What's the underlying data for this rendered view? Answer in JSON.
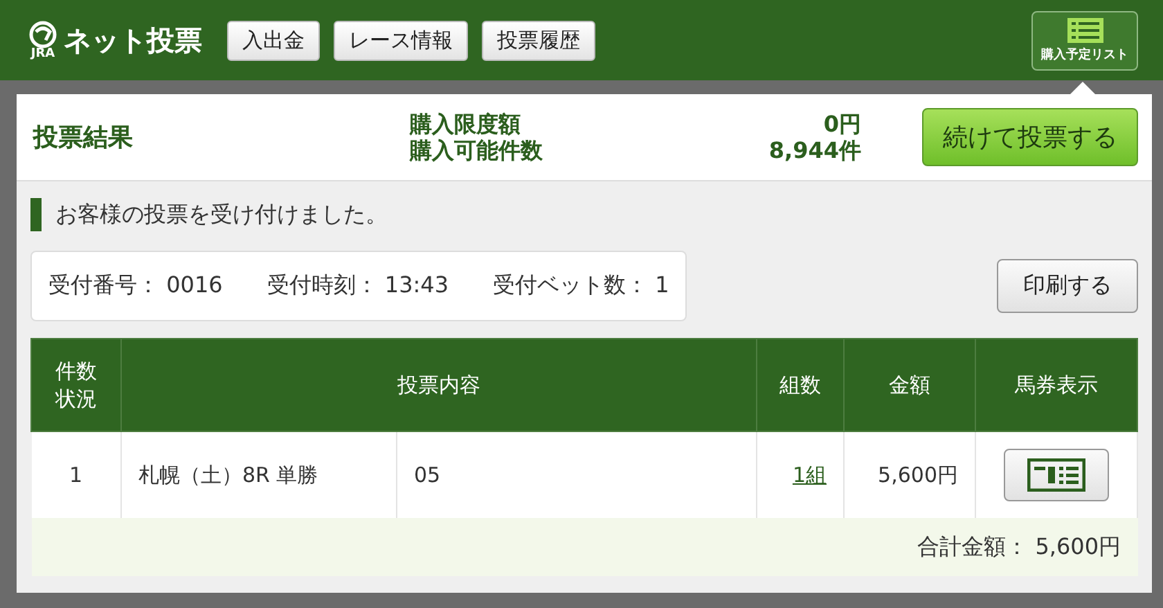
{
  "header": {
    "logo_mark": "JRA",
    "title": "ネット投票",
    "nav": [
      "入出金",
      "レース情報",
      "投票履歴"
    ],
    "list_button": "購入予定リスト"
  },
  "summary": {
    "title": "投票結果",
    "limits": [
      {
        "label": "購入限度額",
        "value": "0円"
      },
      {
        "label": "購入可能件数",
        "value": "8,944件"
      }
    ],
    "continue_button": "続けて投票する"
  },
  "message": "お客様の投票を受け付けました。",
  "receipt": [
    {
      "label": "受付番号：",
      "value": "0016"
    },
    {
      "label": "受付時刻：",
      "value": "13:43"
    },
    {
      "label": "受付ベット数：",
      "value": "1"
    }
  ],
  "print_button": "印刷する",
  "table": {
    "columns": [
      "件数状況",
      "投票内容",
      "組数",
      "金額",
      "馬券表示"
    ],
    "rows": [
      {
        "count": "1",
        "race": "札幌（土）8R 単勝",
        "selection": "05",
        "combos": "1組",
        "amount": "5,600円"
      }
    ],
    "total": {
      "label": "合計金額：",
      "value": "5,600円"
    }
  }
}
